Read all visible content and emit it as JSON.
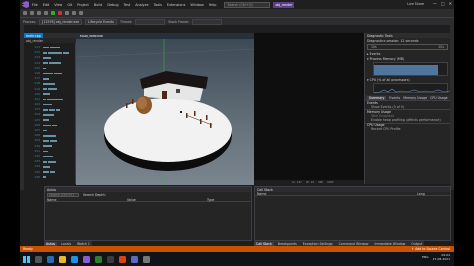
{
  "titlebar": {
    "menu": [
      "File",
      "Edit",
      "View",
      "Git",
      "Project",
      "Build",
      "Debug",
      "Test",
      "Analyze",
      "Tools",
      "Extensions",
      "Window",
      "Help"
    ],
    "search_placeholder": "Search (Ctrl+Q)",
    "solution_name": "obj_render",
    "live_share": "Live Share",
    "controls": [
      "—",
      "□",
      "✕"
    ]
  },
  "toolbar": {
    "process_label": "Process:",
    "process_value": "[12576] obj_render.exe",
    "lifecycle_label": "Lifecycle Events",
    "thread_label": "Thread:",
    "stack_label": "Stack Frame:"
  },
  "editor": {
    "tab": "main.cpp",
    "crumb": "obj_render",
    "line_numbers": [
      "111",
      "112",
      "113",
      "114",
      "115",
      "116",
      "117",
      "118",
      "119",
      "120",
      "121",
      "122",
      "123",
      "124",
      "125",
      "126",
      "127",
      "128",
      "129",
      "130",
      "131",
      "132",
      "133",
      "134",
      "135",
      "136"
    ]
  },
  "game": {
    "title": "MAIN_WINDOW"
  },
  "center_status": {
    "ln": "Ln: 127",
    "ch": "Ch: 22",
    "mode": "SPC",
    "eol": "CRLF"
  },
  "diagnostics": {
    "title": "Diagnostic Tools",
    "session": "Diagnostics session: 12 seconds",
    "ruler": [
      "10s",
      "20s"
    ],
    "events_label": "▸ Events",
    "memory_label": "▾ Process Memory (MB)",
    "memory_min": "0",
    "memory_max": "85",
    "cpu_label": "▾ CPU (% of all processors)",
    "cpu_min": "0",
    "cpu_max": "100",
    "tabs": [
      "Summary",
      "Events",
      "Memory Usage",
      "CPU Usage"
    ],
    "sections": [
      {
        "heading": "Events",
        "items": [
          {
            "text": "Show Events (0 of 0)",
            "dim": false
          }
        ]
      },
      {
        "heading": "Memory Usage",
        "items": [
          {
            "text": "Take Snapshot",
            "dim": true
          },
          {
            "text": "Enable heap profiling (affects performance)",
            "dim": false
          }
        ]
      },
      {
        "heading": "CPU Usage",
        "items": [
          {
            "text": "Record CPU Profile",
            "dim": false
          }
        ]
      }
    ]
  },
  "autos": {
    "title": "Autos",
    "search_placeholder": "Search (Ctrl+E)",
    "search_depth_label": "Search Depth:",
    "columns": [
      "Name",
      "Value",
      "Type"
    ]
  },
  "callstack": {
    "title": "Call Stack",
    "columns": [
      "Name",
      "Lang"
    ]
  },
  "bottom_tabs_left": [
    "Autos",
    "Locals",
    "Watch 1"
  ],
  "bottom_tabs_right": [
    "Call Stack",
    "Breakpoints",
    "Exception Settings",
    "Command Window",
    "Immediate Window",
    "Output"
  ],
  "status": {
    "ready": "Ready",
    "add_source": "↑ Add to Source Control"
  },
  "taskbar": {
    "time": "09:04",
    "date": "27-08-2021",
    "lang": "ENG"
  },
  "colors": {
    "status_bar": "#ca5100",
    "accent": "#007acc",
    "vs_purple": "#8a5cd1"
  }
}
